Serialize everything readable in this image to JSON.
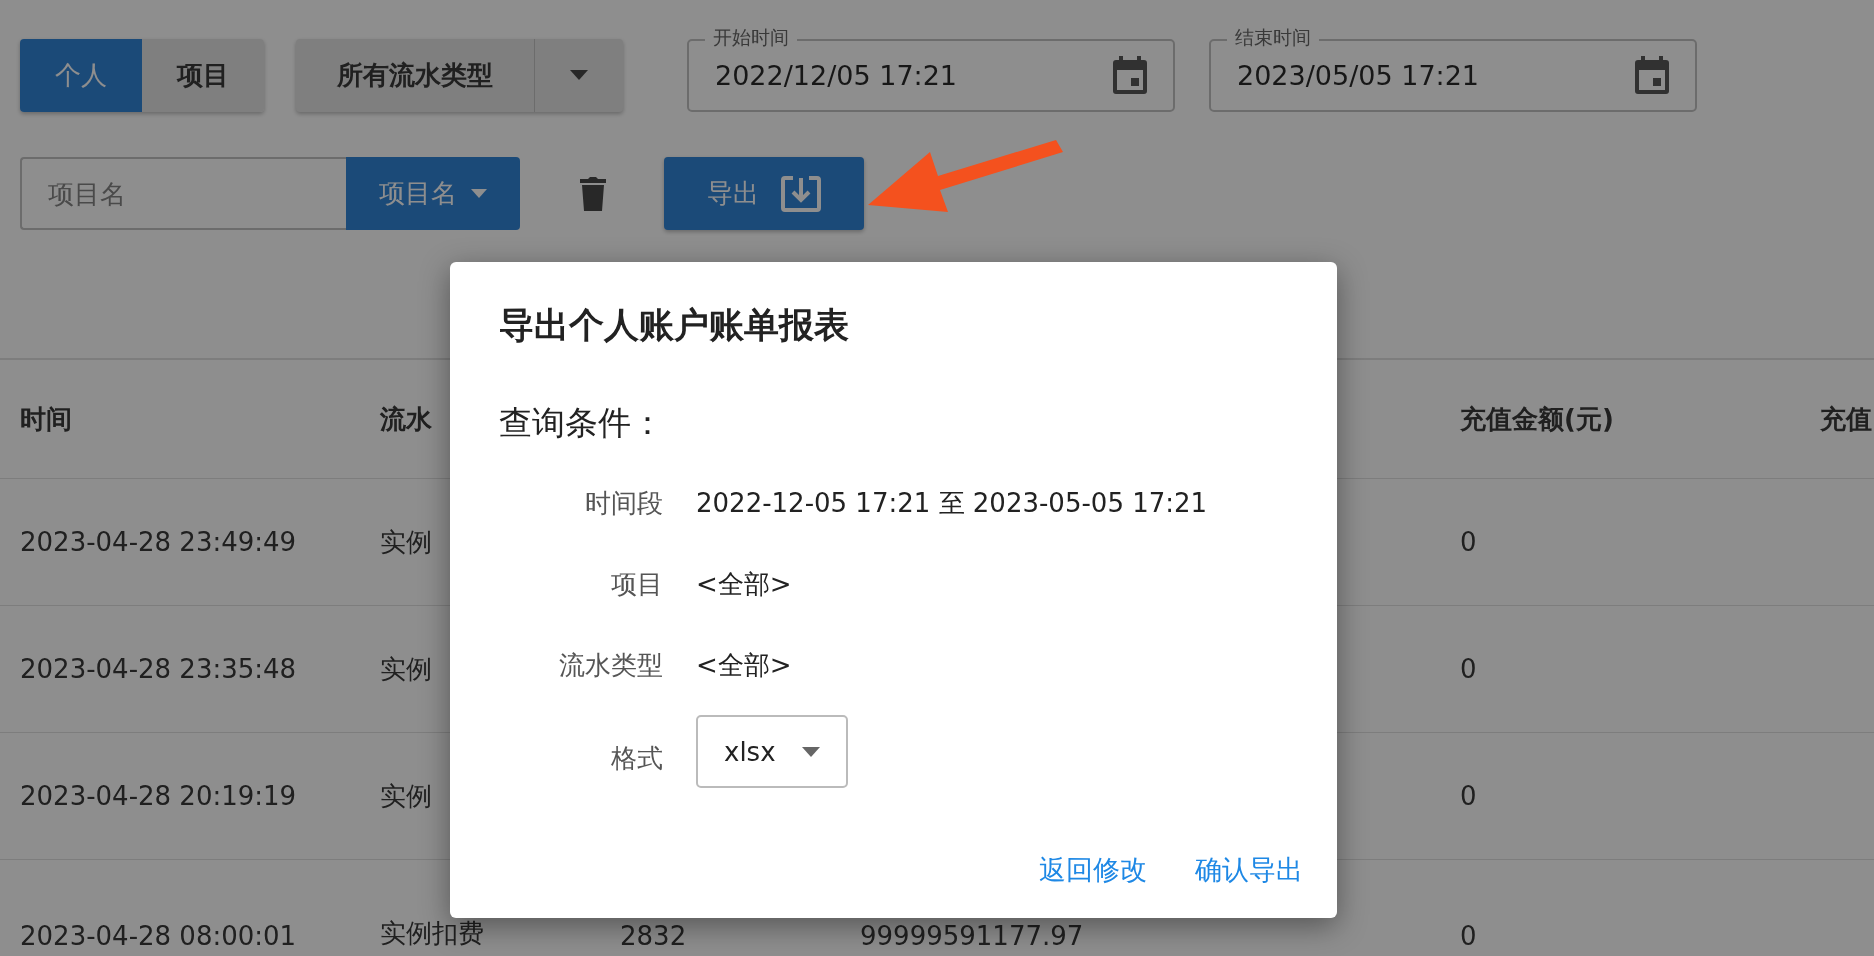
{
  "view_toggle": [
    {
      "label": "个人",
      "selected": true
    },
    {
      "label": "项目",
      "selected": false
    }
  ],
  "type_filter": {
    "value": "所有流水类型"
  },
  "start_time": {
    "label": "开始时间",
    "value": "2022/12/05 17:21"
  },
  "end_time": {
    "label": "结束时间",
    "value": "2023/05/05 17:21"
  },
  "project_search": {
    "placeholder": "项目名",
    "mode": "项目名"
  },
  "export_button": {
    "label": "导出"
  },
  "table": {
    "header": {
      "time": "时间",
      "type": "流水",
      "recharge_amount": "充值金额(元)",
      "column_6": "充值"
    },
    "rows": [
      {
        "time": "2023-04-28 23:49:49",
        "type": "实例",
        "recharge_amount": "0"
      },
      {
        "time": "2023-04-28 23:35:48",
        "type": "实例",
        "recharge_amount": "0"
      },
      {
        "time": "2023-04-28 20:19:19",
        "type": "实例",
        "recharge_amount": "0"
      },
      {
        "time": "2023-04-28 08:00:01",
        "type": "实例扣费",
        "column_3": "2832",
        "column_4": "99999591177.97",
        "recharge_amount": "0"
      }
    ]
  },
  "dialog": {
    "title": "导出个人账户账单报表",
    "section": "查询条件：",
    "fields": [
      {
        "label": "时间段",
        "value": "2022-12-05 17:21 至 2023-05-05 17:21"
      },
      {
        "label": "项目",
        "value": "<全部>"
      },
      {
        "label": "流水类型",
        "value": "<全部>"
      }
    ],
    "format": {
      "label": "格式",
      "value": "xlsx"
    },
    "actions": [
      "返回修改",
      "确认导出"
    ]
  }
}
